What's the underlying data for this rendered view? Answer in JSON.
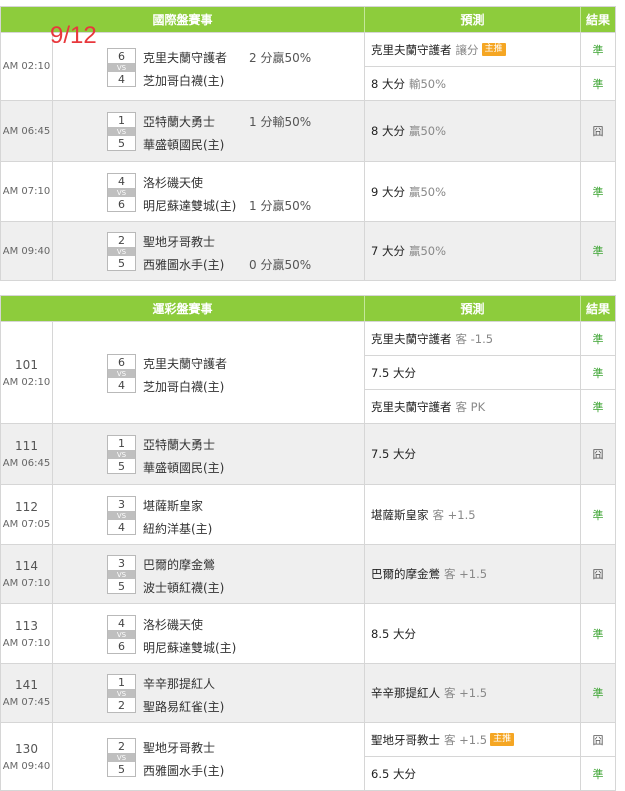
{
  "date_mark": "9/12",
  "intl": {
    "header": {
      "match": "國際盤賽事",
      "prediction": "預測",
      "result": "結果"
    },
    "rows": [
      {
        "time": "AM 02:10",
        "home_score": "6",
        "away_score": "4",
        "team1": "克里夫蘭守護者",
        "team2": "芝加哥白襪(主)",
        "handicap": "2 分贏50%",
        "handicap_row": 1,
        "preds": [
          {
            "text": "克里夫蘭守護者",
            "sub": "讓分",
            "badge": "主推",
            "result": "準"
          },
          {
            "text": "8 大分",
            "sub": "輸50%",
            "result": "準"
          }
        ]
      },
      {
        "time": "AM 06:45",
        "home_score": "1",
        "away_score": "5",
        "team1": "亞特蘭大勇士",
        "team2": "華盛頓國民(主)",
        "handicap": "1 分輸50%",
        "handicap_row": 1,
        "preds": [
          {
            "text": "8 大分",
            "sub": "贏50%",
            "result": "囧"
          }
        ]
      },
      {
        "time": "AM 07:10",
        "home_score": "4",
        "away_score": "6",
        "team1": "洛杉磯天使",
        "team2": "明尼蘇達雙城(主)",
        "handicap": "1 分贏50%",
        "handicap_row": 2,
        "preds": [
          {
            "text": "9 大分",
            "sub": "贏50%",
            "result": "準"
          }
        ]
      },
      {
        "time": "AM 09:40",
        "home_score": "2",
        "away_score": "5",
        "team1": "聖地牙哥教士",
        "team2": "西雅圖水手(主)",
        "handicap": "0 分贏50%",
        "handicap_row": 2,
        "preds": [
          {
            "text": "7 大分",
            "sub": "贏50%",
            "result": "準"
          }
        ]
      }
    ]
  },
  "lottery": {
    "header": {
      "match": "運彩盤賽事",
      "prediction": "預測",
      "result": "結果"
    },
    "rows": [
      {
        "num": "101",
        "time": "AM 02:10",
        "home_score": "6",
        "away_score": "4",
        "team1": "克里夫蘭守護者",
        "team2": "芝加哥白襪(主)",
        "preds": [
          {
            "text": "克里夫蘭守護者",
            "sub": "客 -1.5",
            "result": "準"
          },
          {
            "text": "7.5 大分",
            "sub": "",
            "result": "準"
          },
          {
            "text": "克里夫蘭守護者",
            "sub": "客 PK",
            "result": "準"
          }
        ]
      },
      {
        "num": "111",
        "time": "AM 06:45",
        "home_score": "1",
        "away_score": "5",
        "team1": "亞特蘭大勇士",
        "team2": "華盛頓國民(主)",
        "preds": [
          {
            "text": "7.5 大分",
            "sub": "",
            "result": "囧"
          }
        ]
      },
      {
        "num": "112",
        "time": "AM 07:05",
        "home_score": "3",
        "away_score": "4",
        "team1": "堪薩斯皇家",
        "team2": "紐約洋基(主)",
        "preds": [
          {
            "text": "堪薩斯皇家",
            "sub": "客 +1.5",
            "result": "準"
          }
        ]
      },
      {
        "num": "114",
        "time": "AM 07:10",
        "home_score": "3",
        "away_score": "5",
        "team1": "巴爾的摩金鶯",
        "team2": "波士頓紅襪(主)",
        "preds": [
          {
            "text": "巴爾的摩金鶯",
            "sub": "客 +1.5",
            "result": "囧"
          }
        ]
      },
      {
        "num": "113",
        "time": "AM 07:10",
        "home_score": "4",
        "away_score": "6",
        "team1": "洛杉磯天使",
        "team2": "明尼蘇達雙城(主)",
        "preds": [
          {
            "text": "8.5 大分",
            "sub": "",
            "result": "準"
          }
        ]
      },
      {
        "num": "141",
        "time": "AM 07:45",
        "home_score": "1",
        "away_score": "2",
        "team1": "辛辛那提紅人",
        "team2": "聖路易紅雀(主)",
        "preds": [
          {
            "text": "辛辛那提紅人",
            "sub": "客 +1.5",
            "result": "準"
          }
        ]
      },
      {
        "num": "130",
        "time": "AM 09:40",
        "home_score": "2",
        "away_score": "5",
        "team1": "聖地牙哥教士",
        "team2": "西雅圖水手(主)",
        "preds": [
          {
            "text": "聖地牙哥教士",
            "sub": "客 +1.5",
            "badge": "主推",
            "result": "囧"
          },
          {
            "text": "6.5 大分",
            "sub": "",
            "result": "準"
          }
        ]
      }
    ]
  },
  "vs_label": "VS",
  "colors": {
    "header_green": "#8dcc3c",
    "win_green": "#3fa535",
    "badge_orange": "#f5a623",
    "date_red": "#e8383d"
  }
}
